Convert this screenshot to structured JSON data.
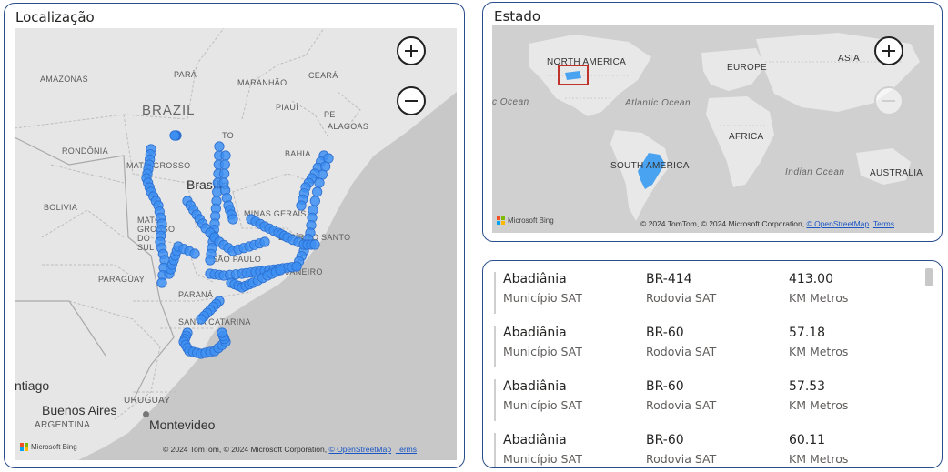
{
  "localizacao": {
    "title": "Localização",
    "labels": {
      "amazonas": "AMAZONAS",
      "para": "PARÁ",
      "maranhao": "MARANHÃO",
      "ceara": "CEARÁ",
      "brazil": "BRAZIL",
      "piaui": "PIAUÍ",
      "pe": "PE",
      "alagoas": "ALAGOAS",
      "to": "TO",
      "rondonia": "RONDÔNIA",
      "bahia": "BAHIA",
      "mato_grosso": "MATO GROSSO",
      "brasilia": "Brasília",
      "bolivia": "BOLIVIA",
      "minas_gerais": "MINAS GERAIS",
      "mato_grosso_sul": "MATO GROSSO DO SUL",
      "espirito_santo": "ESPÍRITO SANTO",
      "sao_paulo": "SÃO PAULO",
      "paraguay": "PARAGUAY",
      "rio": "RIO DE JANEIRO",
      "parana": "PARANÁ",
      "santa_catarina": "SANTA CATARINA",
      "santiago": "ntiago",
      "uruguay": "URUGUAY",
      "buenos_aires": "Buenos Aires",
      "argentina": "ARGENTINA",
      "montevideo": "Montevideo"
    },
    "attribution": "© 2024 TomTom, © 2024 Microsoft Corporation,",
    "osm_link": "© OpenStreetMap",
    "terms": "Terms",
    "bing": "Microsoft Bing",
    "point_color": "#3d8ff2"
  },
  "estado": {
    "title": "Estado",
    "labels": {
      "north_america": "NORTH AMERICA",
      "europe": "EUROPE",
      "asia": "ASIA",
      "ocean_left": "c Ocean",
      "atlantic": "Atlantic Ocean",
      "africa": "AFRICA",
      "south_america": "SOUTH AMERICA",
      "indian": "Indian Ocean",
      "australia": "AUSTRALIA"
    },
    "attribution": "© 2024 TomTom, © 2024 Microsoft Corporation,",
    "osm_link": "© OpenStreetMap",
    "terms": "Terms",
    "bing": "Microsoft Bing",
    "highlight_color": "#4aa3f0",
    "selection_color": "#c0332b"
  },
  "table": {
    "rows": [
      {
        "municipio": "Abadiânia",
        "municipio_label": "Município SAT",
        "rodovia": "BR-414",
        "rodovia_label": "Rodovia SAT",
        "km": "413.00",
        "km_label": "KM Metros"
      },
      {
        "municipio": "Abadiânia",
        "municipio_label": "Município SAT",
        "rodovia": "BR-60",
        "rodovia_label": "Rodovia SAT",
        "km": "57.18",
        "km_label": "KM Metros"
      },
      {
        "municipio": "Abadiânia",
        "municipio_label": "Município SAT",
        "rodovia": "BR-60",
        "rodovia_label": "Rodovia SAT",
        "km": "57.53",
        "km_label": "KM Metros"
      },
      {
        "municipio": "Abadiânia",
        "municipio_label": "Município SAT",
        "rodovia": "BR-60",
        "rodovia_label": "Rodovia SAT",
        "km": "60.11",
        "km_label": "KM Metros"
      }
    ]
  }
}
